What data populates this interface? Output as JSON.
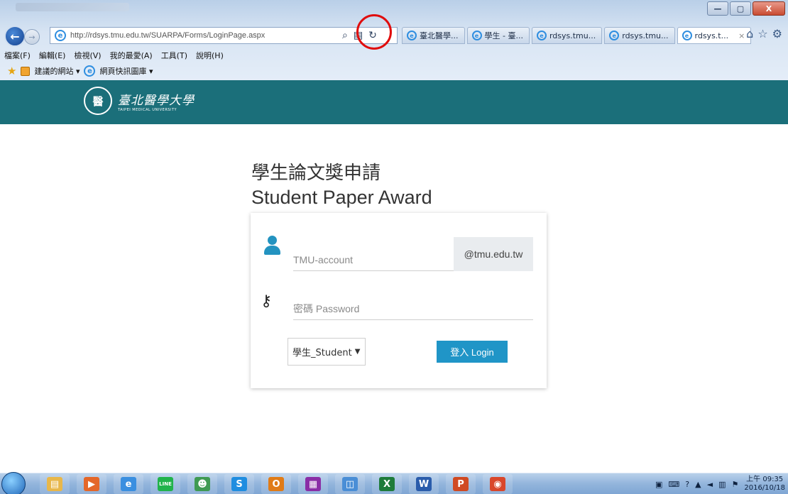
{
  "browser": {
    "url": "http://rdsys.tmu.edu.tw/SUARPA/Forms/LoginPage.aspx",
    "tabs": [
      {
        "label": "臺北醫學...",
        "active": false
      },
      {
        "label": "學生 - 臺...",
        "active": false
      },
      {
        "label": "rdsys.tmu...",
        "active": false
      },
      {
        "label": "rdsys.tmu...",
        "active": false
      },
      {
        "label": "rdsys.t...",
        "active": true
      }
    ],
    "menu": [
      "檔案(F)",
      "編輯(E)",
      "檢視(V)",
      "我的最愛(A)",
      "工具(T)",
      "說明(H)"
    ],
    "favorites": {
      "suggested": "建議的網站 ▾",
      "gallery": "網頁快訊圖庫 ▾"
    },
    "window_controls": {
      "minimize": "—",
      "maximize": "▢",
      "close": "X"
    }
  },
  "site": {
    "logo_cn": "臺北醫學大學",
    "logo_en": "TAIPEI MEDICAL UNIVERSITY",
    "logo_seal": "醫"
  },
  "page": {
    "title_cn": "學生論文獎申請",
    "title_en": "Student Paper Award"
  },
  "form": {
    "account_placeholder": "TMU-account",
    "account_value": "",
    "account_suffix": "@tmu.edu.tw",
    "password_placeholder": "密碼 Password",
    "password_value": "",
    "role_selected": "學生_Student",
    "login_label": "登入 Login"
  },
  "taskbar": {
    "apps": [
      {
        "name": "explorer",
        "glyph": "▤",
        "color": "#e8b74a"
      },
      {
        "name": "media-player",
        "glyph": "▶",
        "color": "#e4672a"
      },
      {
        "name": "internet-explorer",
        "glyph": "e",
        "color": "#3a8fe0"
      },
      {
        "name": "line",
        "glyph": "LINE",
        "color": "#21b34b"
      },
      {
        "name": "users",
        "glyph": "☻",
        "color": "#3f9a52"
      },
      {
        "name": "skype",
        "glyph": "S",
        "color": "#1f8de0"
      },
      {
        "name": "outlook",
        "glyph": "O",
        "color": "#e07b17"
      },
      {
        "name": "winrar",
        "glyph": "▦",
        "color": "#8a2ea6"
      },
      {
        "name": "network",
        "glyph": "◫",
        "color": "#4a8ed6"
      },
      {
        "name": "excel",
        "glyph": "X",
        "color": "#1e7b3a"
      },
      {
        "name": "word",
        "glyph": "W",
        "color": "#2a5cab"
      },
      {
        "name": "powerpoint",
        "glyph": "P",
        "color": "#d04a23"
      },
      {
        "name": "chrome",
        "glyph": "◉",
        "color": "#d9472b"
      }
    ],
    "clock_time": "上午 09:35",
    "clock_date": "2016/10/18"
  },
  "colors": {
    "header_teal": "#1b6f7a",
    "accent_blue": "#2095c7",
    "highlight_red": "#e00d0d"
  }
}
